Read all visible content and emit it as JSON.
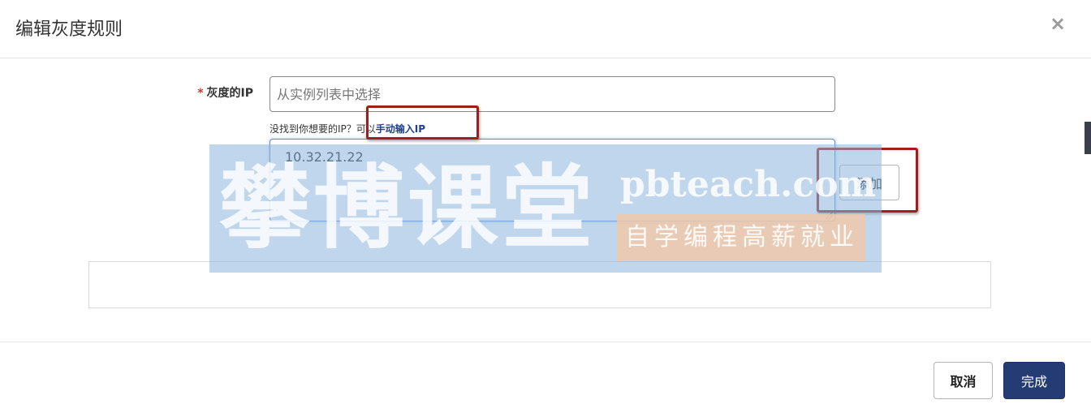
{
  "dialog": {
    "title": "编辑灰度规则",
    "close_symbol": "×"
  },
  "form": {
    "required_mark": "*",
    "ip_label": "灰度的IP",
    "select_placeholder": "从实例列表中选择",
    "help_text": "没找到你想要的IP？可以",
    "help_link": "手动输入IP",
    "textarea_value": "10.32.21.22",
    "add_button": "添加"
  },
  "footer": {
    "cancel_label": "取消",
    "done_label": "完成"
  },
  "watermark": {
    "big_text": "攀博课堂",
    "site": "pbteach.com",
    "slogan": "自学编程高薪就业"
  },
  "colors": {
    "primary": "#243b73",
    "link": "#1f3f8f",
    "required": "#c0392b",
    "annotation": "#a31d1d",
    "focus_border": "#5b8fd8"
  },
  "icons": {
    "close": "close-icon",
    "resize": "resize-grip-icon"
  }
}
